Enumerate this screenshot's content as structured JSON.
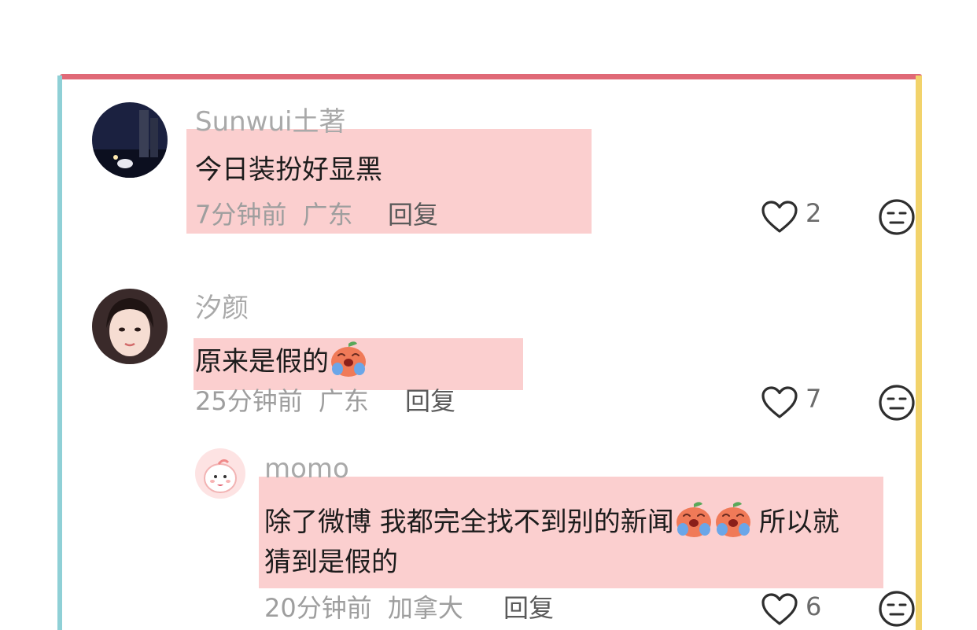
{
  "comments": [
    {
      "username": "Sunwui土著",
      "text": "今日装扮好显黑",
      "time": "7分钟前",
      "location": "广东",
      "reply_label": "回复",
      "likes": "2",
      "avatar_icon": "night-city-photo-avatar"
    },
    {
      "username": "汐颜",
      "text": "原来是假的",
      "emoji": "crying-peach-emoji",
      "time": "25分钟前",
      "location": "广东",
      "reply_label": "回复",
      "likes": "7",
      "avatar_icon": "girl-portrait-avatar"
    },
    {
      "username": "momo",
      "text_line1_a": "除了微博 我都完全找不到别的新闻",
      "text_line1_b": "所以就",
      "text_line2": "猜到是假的",
      "emoji": "crying-peach-emoji",
      "time": "20分钟前",
      "location": "加拿大",
      "reply_label": "回复",
      "likes": "6",
      "avatar_icon": "cartoon-peach-avatar"
    }
  ],
  "colors": {
    "frame_top": "#e06977",
    "frame_left": "#8fd0d6",
    "frame_right": "#f2d36b",
    "highlight": "#fbcfcf"
  }
}
